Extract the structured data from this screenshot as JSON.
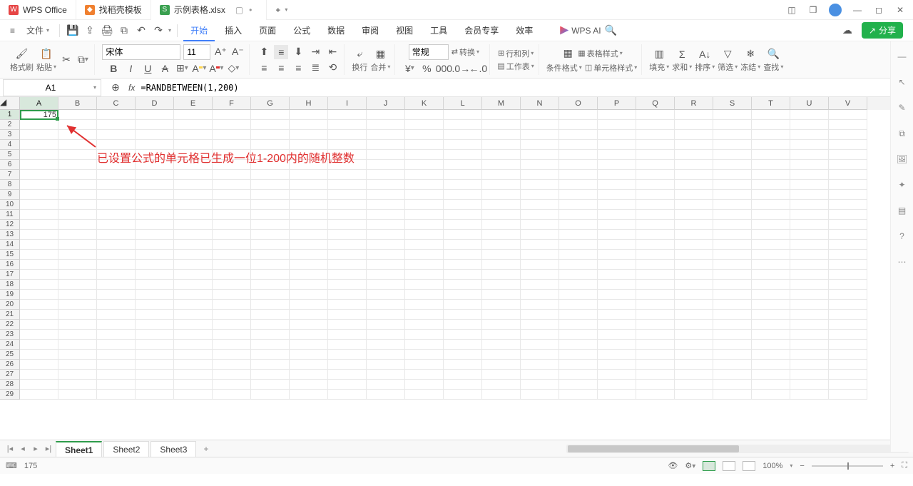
{
  "titlebar": {
    "app_tabs": [
      {
        "label": "WPS Office",
        "icon_color": "wps-red"
      },
      {
        "label": "找稻壳模板",
        "icon_color": "docer-orange"
      },
      {
        "label": "示例表格.xlsx",
        "icon_color": "xlsx-green"
      }
    ],
    "tab_add": "+"
  },
  "menubar": {
    "file": "文件",
    "tabs": [
      "开始",
      "插入",
      "页面",
      "公式",
      "数据",
      "审阅",
      "视图",
      "工具",
      "会员专享",
      "效率"
    ],
    "active_tab_index": 0,
    "wpsai": "WPS AI",
    "share": "分享"
  },
  "ribbon": {
    "format_painter": "格式刷",
    "paste": "粘贴",
    "font_name": "宋体",
    "font_size": "11",
    "number_format": "常规",
    "wrap": "换行",
    "merge": "合并",
    "convert": "转换",
    "row_col": "行和列",
    "worksheet": "工作表",
    "table_style": "表格样式",
    "cond_fmt": "条件格式",
    "cell_style": "单元格样式",
    "fill": "填充",
    "sum": "求和",
    "sort": "排序",
    "filter": "筛选",
    "freeze": "冻结",
    "find": "查找"
  },
  "formula_bar": {
    "cell_ref": "A1",
    "formula": "=RANDBETWEEN(1,200)"
  },
  "grid": {
    "columns": [
      "A",
      "B",
      "C",
      "D",
      "E",
      "F",
      "G",
      "H",
      "I",
      "J",
      "K",
      "L",
      "M",
      "N",
      "O",
      "P",
      "Q",
      "R",
      "S",
      "T",
      "U",
      "V"
    ],
    "rows": 29,
    "active_cell_value": "175",
    "annotation_text": "已设置公式的单元格已生成一位1-200内的随机整数"
  },
  "sheets": {
    "tabs": [
      "Sheet1",
      "Sheet2",
      "Sheet3"
    ],
    "active_index": 0
  },
  "statusbar": {
    "left_value": "175",
    "zoom": "100%"
  }
}
